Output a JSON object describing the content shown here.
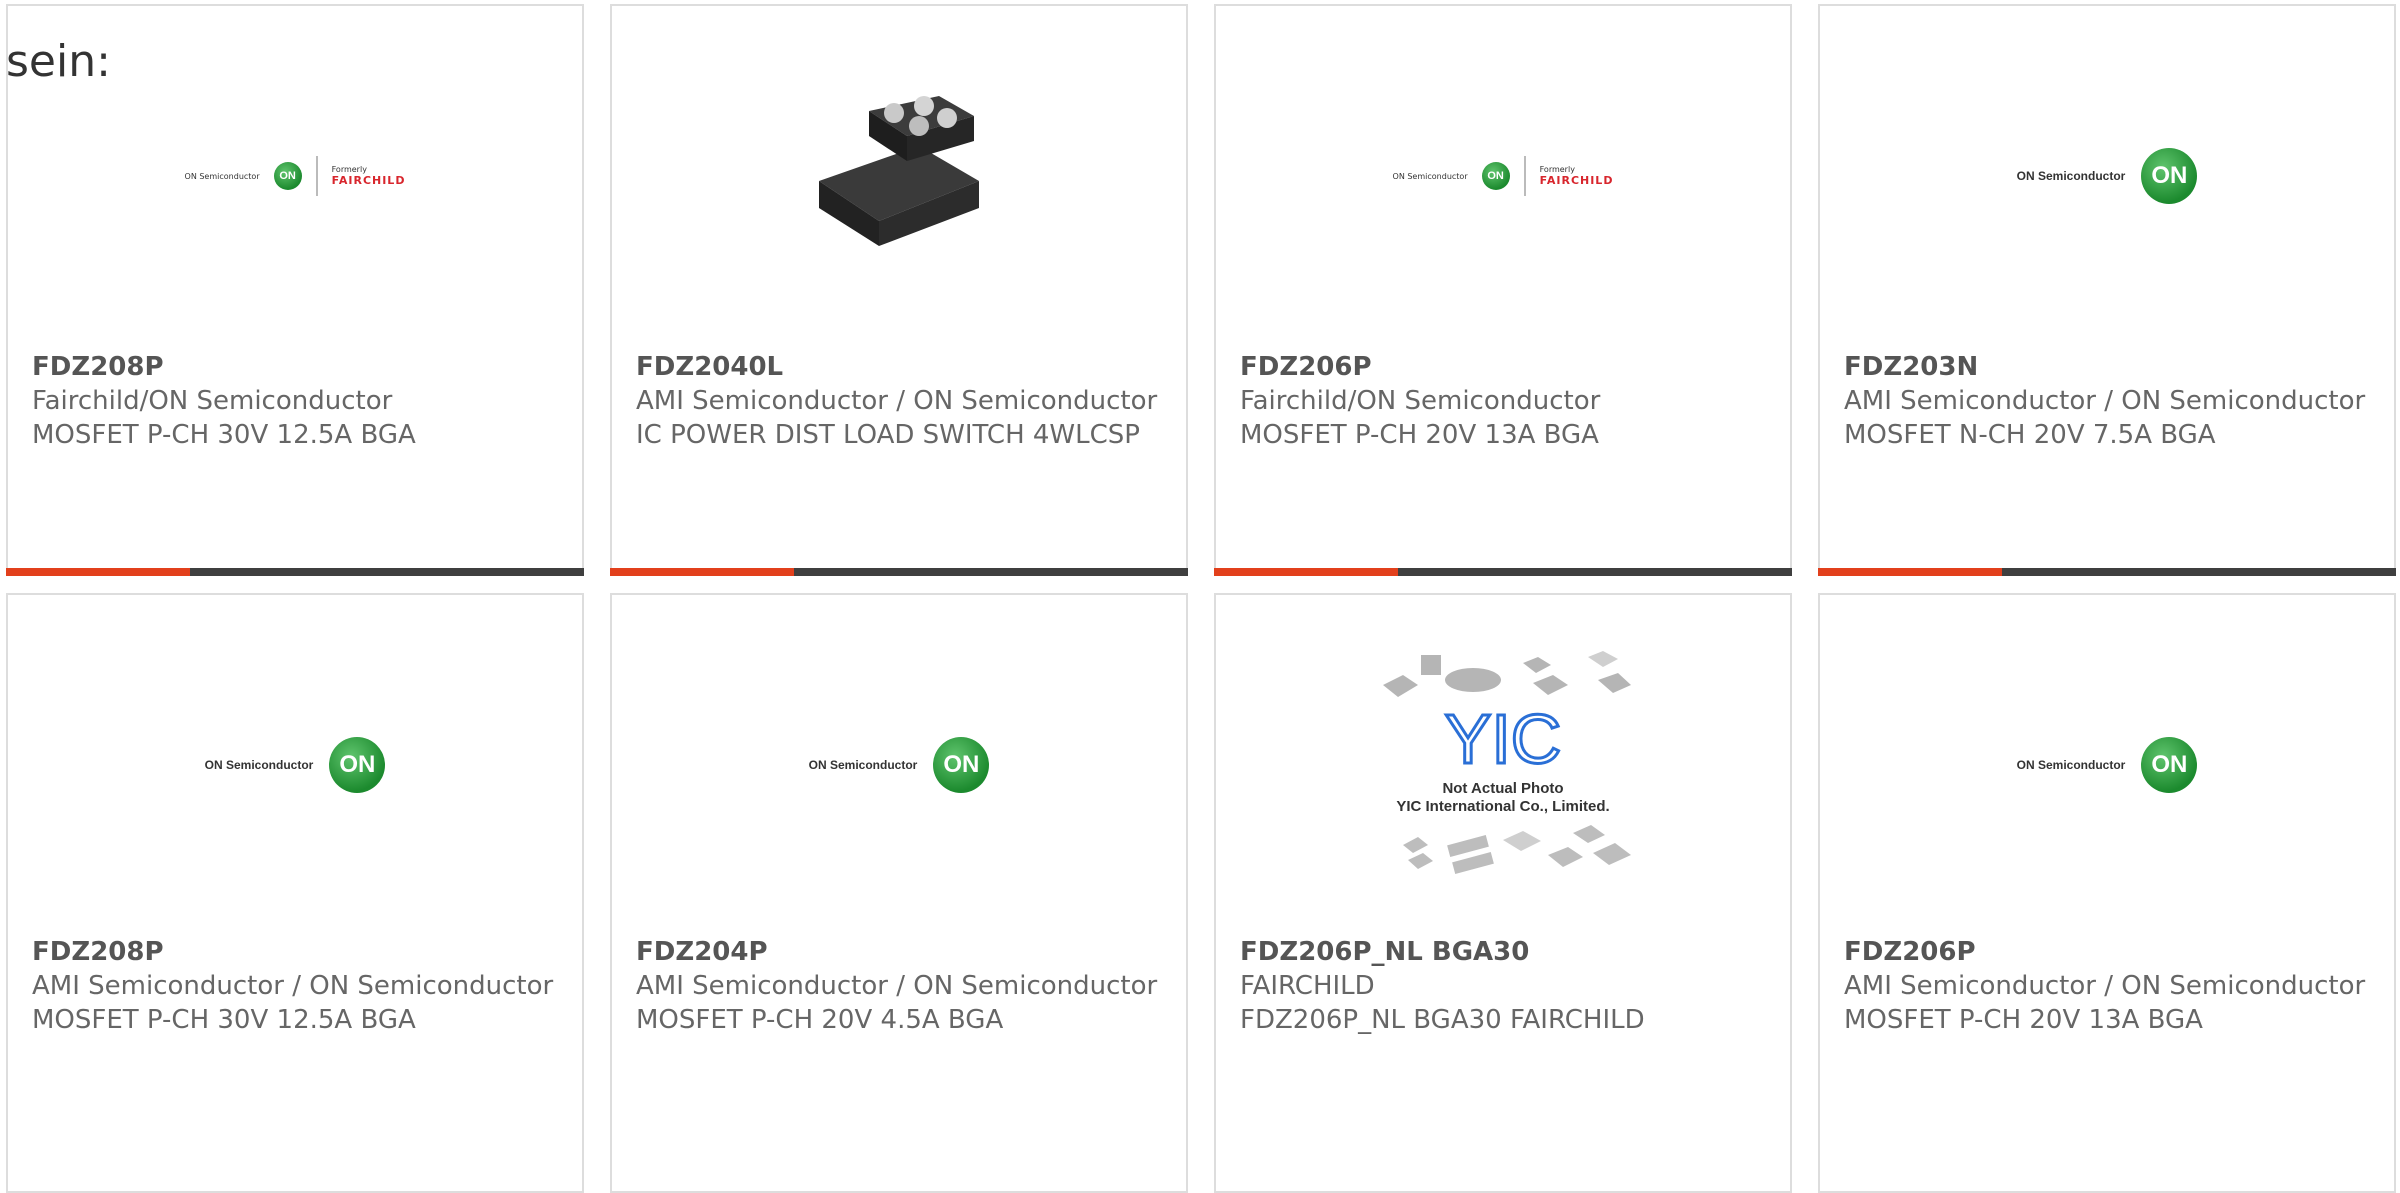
{
  "lead_text": "sein:",
  "brand": {
    "accent": "#e2401c",
    "bar_dark": "#3f3f3f",
    "on_green": "#2a9a3c",
    "fairchild_red": "#d8262d"
  },
  "logos": {
    "on_semi_small": "ON Semiconductor",
    "on_mark": "ON",
    "formerly": "Formerly",
    "fairchild": "FAIRCHILD",
    "on_semi_large": "ON Semiconductor",
    "yic_not_actual": "Not Actual Photo",
    "yic_company": "YIC International Co., Limited."
  },
  "products": [
    {
      "part": "FDZ208P",
      "maker": "Fairchild/ON Semiconductor",
      "desc": "MOSFET P-CH 30V 12.5A BGA",
      "image": "on-fairchild-logo"
    },
    {
      "part": "FDZ2040L",
      "maker": "AMI Semiconductor / ON Semiconductor",
      "desc": "IC POWER DIST LOAD SWITCH 4WLCSP",
      "image": "chip-photo"
    },
    {
      "part": "FDZ206P",
      "maker": "Fairchild/ON Semiconductor",
      "desc": "MOSFET P-CH 20V 13A BGA",
      "image": "on-fairchild-logo"
    },
    {
      "part": "FDZ203N",
      "maker": "AMI Semiconductor / ON Semiconductor",
      "desc": "MOSFET N-CH 20V 7.5A BGA",
      "image": "on-semi-logo"
    },
    {
      "part": "FDZ208P",
      "maker": "AMI Semiconductor / ON Semiconductor",
      "desc": "MOSFET P-CH 30V 12.5A BGA",
      "image": "on-semi-logo"
    },
    {
      "part": "FDZ204P",
      "maker": "AMI Semiconductor / ON Semiconductor",
      "desc": "MOSFET P-CH 20V 4.5A BGA",
      "image": "on-semi-logo"
    },
    {
      "part": "FDZ206P_NL BGA30",
      "maker": "FAIRCHILD",
      "desc": "FDZ206P_NL BGA30 FAIRCHILD",
      "image": "yic-placeholder"
    },
    {
      "part": "FDZ206P",
      "maker": "AMI Semiconductor / ON Semiconductor",
      "desc": "MOSFET P-CH 20V 13A BGA",
      "image": "on-semi-logo"
    }
  ]
}
